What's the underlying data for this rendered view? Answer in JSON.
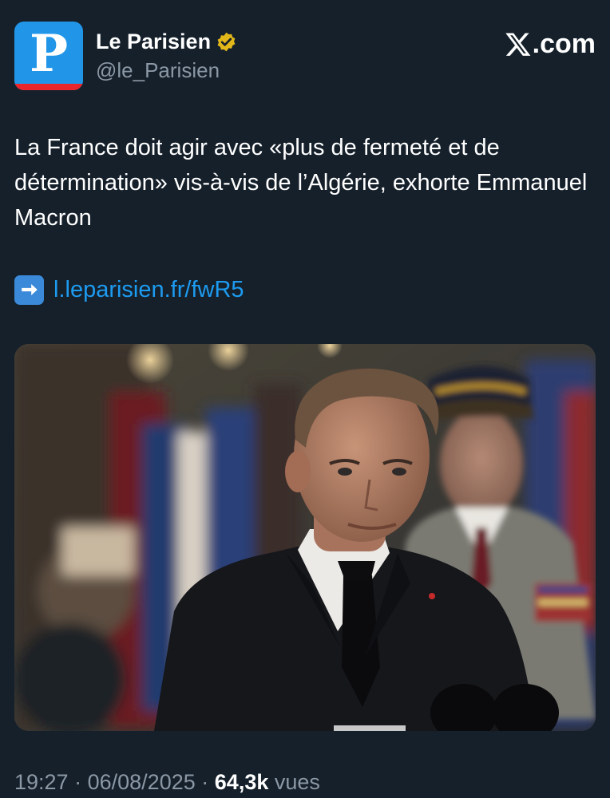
{
  "account": {
    "display_name": "Le Parisien",
    "handle": "@le_Parisien",
    "avatar_letter": "P",
    "avatar_color": "#2196e8",
    "avatar_stripe_color": "#e8262b",
    "verified_badge_color": "#e2b719"
  },
  "brand": {
    "suffix": ".com"
  },
  "tweet": {
    "text": "La France doit agir avec «plus de fermeté et de détermination» vis-à-vis de l’Algérie, exhorte Emmanuel Macron",
    "link_icon": "right-arrow-emoji",
    "link_text": "l.leparisien.fr/fwR5",
    "link_color": "#1d9bf0"
  },
  "meta": {
    "time": "19:27",
    "separator": "·",
    "date": "06/08/2025",
    "views_count": "64,3k",
    "views_label": "vues"
  },
  "colors": {
    "background": "#15202b",
    "secondary_text": "#8b98a5"
  }
}
